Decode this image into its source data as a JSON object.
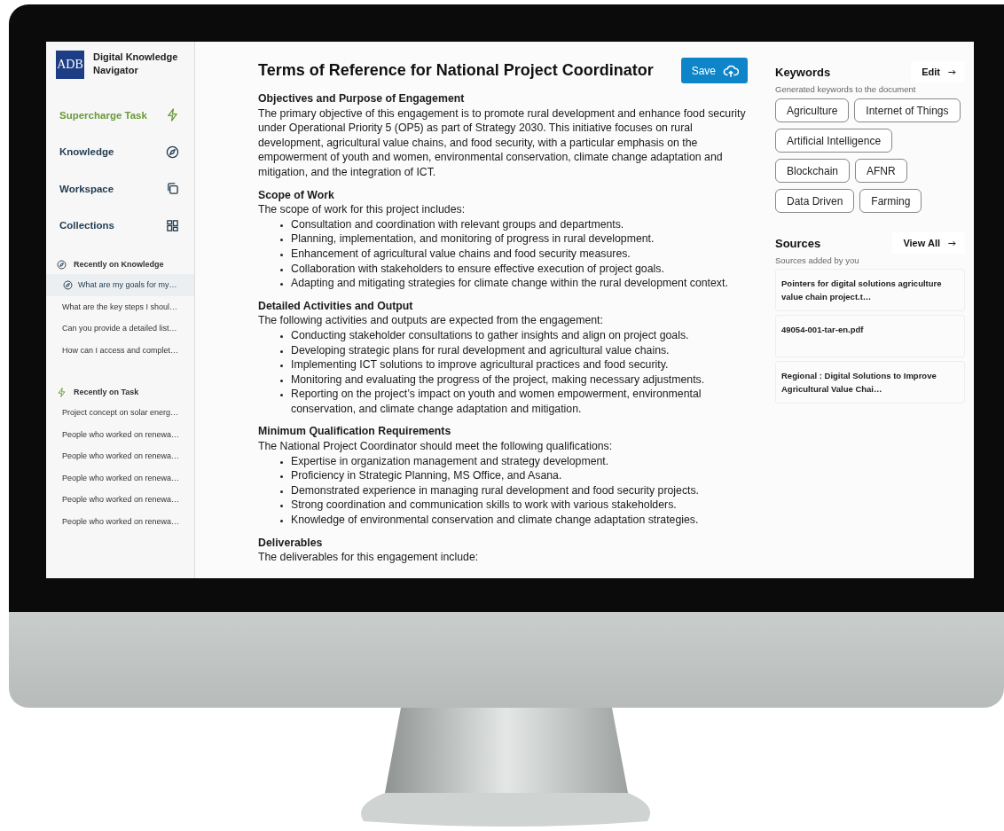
{
  "app": {
    "logo": "ADB",
    "name": "Digital Knowledge Navigator"
  },
  "nav": [
    {
      "label": "Supercharge Task",
      "kind": "task",
      "selected": true
    },
    {
      "label": "Knowledge",
      "kind": "knowledge",
      "selected": false
    },
    {
      "label": "Workspace",
      "kind": "workspace",
      "selected": false
    },
    {
      "label": "Collections",
      "kind": "collections",
      "selected": false
    }
  ],
  "recent_knowledge": {
    "title": "Recently on Knowledge",
    "items": [
      {
        "label": "What are my goals for my…",
        "selected": true
      },
      {
        "label": "What are the key steps I shoul…",
        "selected": false
      },
      {
        "label": "Can you provide a detailed list…",
        "selected": false
      },
      {
        "label": "How can I access and complet…",
        "selected": false
      }
    ]
  },
  "recent_task": {
    "title": "Recently on Task",
    "items": [
      {
        "label": "Project concept on solar energ…",
        "selected": false
      },
      {
        "label": "People who worked on renewa…",
        "selected": false
      },
      {
        "label": "People who worked on renewa…",
        "selected": false
      },
      {
        "label": "People who worked on renewa…",
        "selected": false
      },
      {
        "label": "People who worked on renewa…",
        "selected": false
      },
      {
        "label": "People who worked on renewa…",
        "selected": false
      }
    ]
  },
  "document": {
    "title": "Terms of Reference for National Project Coordinator",
    "save_label": "Save",
    "sections": [
      {
        "heading": "Objectives and Purpose of Engagement",
        "intro": "The primary objective of this engagement is to promote rural development and enhance food security under Operational Priority 5 (OP5) as part of Strategy 2030. This initiative focuses on rural development, agricultural value chains, and food security, with a particular emphasis on the empowerment of youth and women, environmental conservation, climate change adaptation and mitigation, and the integration of ICT."
      },
      {
        "heading": "Scope of Work",
        "intro": "The scope of work for this project includes:",
        "bullets": [
          "Consultation and coordination with relevant groups and departments.",
          "Planning, implementation, and monitoring of progress in rural development.",
          "Enhancement of agricultural value chains and food security measures.",
          "Collaboration with stakeholders to ensure effective execution of project goals.",
          "Adapting and mitigating strategies for climate change within the rural development context."
        ]
      },
      {
        "heading": "Detailed Activities and Output",
        "intro": "The following activities and outputs are expected from the engagement:",
        "bullets": [
          "Conducting stakeholder consultations to gather insights and align on project goals.",
          "Developing strategic plans for rural development and agricultural value chains.",
          "Implementing ICT solutions to improve agricultural practices and food security.",
          "Monitoring and evaluating the progress of the project, making necessary adjustments.",
          "Reporting on the project’s impact on youth and women empowerment, environmental conservation, and climate change adaptation and mitigation."
        ]
      },
      {
        "heading": "Minimum Qualification Requirements",
        "intro": "The National Project Coordinator should meet the following qualifications:",
        "bullets": [
          "Expertise in organization management and strategy development.",
          "Proficiency in Strategic Planning, MS Office, and Asana.",
          "Demonstrated experience in managing rural development and food security projects.",
          "Strong coordination and communication skills to work with various stakeholders.",
          "Knowledge of environmental conservation and climate change adaptation strategies."
        ]
      },
      {
        "heading": "Deliverables",
        "intro": "The deliverables for this engagement include:"
      }
    ]
  },
  "keywords": {
    "title": "Keywords",
    "edit_label": "Edit",
    "subtitle": "Generated keywords to the document",
    "tags": [
      "Agriculture",
      "Internet of Things",
      "Artificial Intelligence",
      "Blockchain",
      "AFNR",
      "Data Driven",
      "Farming"
    ]
  },
  "sources": {
    "title": "Sources",
    "view_all_label": "View All",
    "subtitle": "Sources added by you",
    "items": [
      "Pointers for digital solutions agriculture value chain project.t…",
      "49054-001-tar-en.pdf",
      "Regional : Digital Solutions to Improve Agricultural Value Chai…"
    ]
  }
}
